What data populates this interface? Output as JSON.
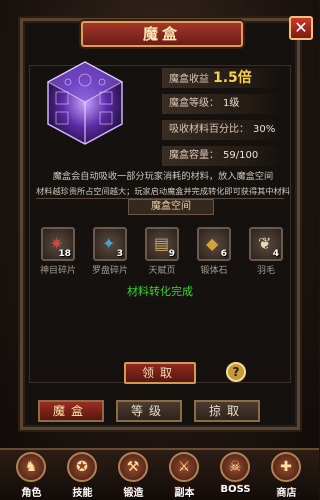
{
  "window": {
    "title": "魔盒"
  },
  "stats": {
    "income_label": "魔盒收益",
    "income_value": "1.5倍",
    "level_label": "魔盒等级：",
    "level_value": "1级",
    "absorb_label": "吸收材料百分比：",
    "absorb_value": "30%",
    "capacity_label": "魔盒容量：",
    "capacity_value": "59/100"
  },
  "description": {
    "line1": "魔盒会自动吸收一部分玩家消耗的材料，放入魔盒空间",
    "line2": "材料越珍贵所占空间越大；玩家启动魔盒并完成转化即可获得其中材料"
  },
  "space": {
    "title": "魔盒空间",
    "items": [
      {
        "name": "神目碎片",
        "count": "18",
        "icon": "eye-shard-icon",
        "glyph": "✷",
        "color": "#d14a3a"
      },
      {
        "name": "罗盘碎片",
        "count": "3",
        "icon": "compass-shard-icon",
        "glyph": "✦",
        "color": "#4aa3d4"
      },
      {
        "name": "天赋页",
        "count": "9",
        "icon": "talent-page-icon",
        "glyph": "▤",
        "color": "#c7a56a"
      },
      {
        "name": "锻体石",
        "count": "6",
        "icon": "forging-stone-icon",
        "glyph": "◆",
        "color": "#d4a23a"
      },
      {
        "name": "羽毛",
        "count": "4",
        "icon": "feather-icon",
        "glyph": "❦",
        "color": "#e6d9b8"
      }
    ],
    "status": "材料转化完成"
  },
  "actions": {
    "claim": "领取",
    "help": "?"
  },
  "tabs": [
    {
      "label": "魔盒",
      "active": true
    },
    {
      "label": "等级",
      "active": false
    },
    {
      "label": "掠取",
      "active": false
    }
  ],
  "nav": [
    {
      "label": "角色",
      "icon": "character-icon",
      "glyph": "♞"
    },
    {
      "label": "技能",
      "icon": "skill-icon",
      "glyph": "✪"
    },
    {
      "label": "锻造",
      "icon": "forge-icon",
      "glyph": "⚒"
    },
    {
      "label": "副本",
      "icon": "dungeon-icon",
      "glyph": "⚔"
    },
    {
      "label": "BOSS",
      "icon": "boss-icon",
      "glyph": "☠"
    },
    {
      "label": "商店",
      "icon": "shop-icon",
      "glyph": "✚"
    }
  ]
}
